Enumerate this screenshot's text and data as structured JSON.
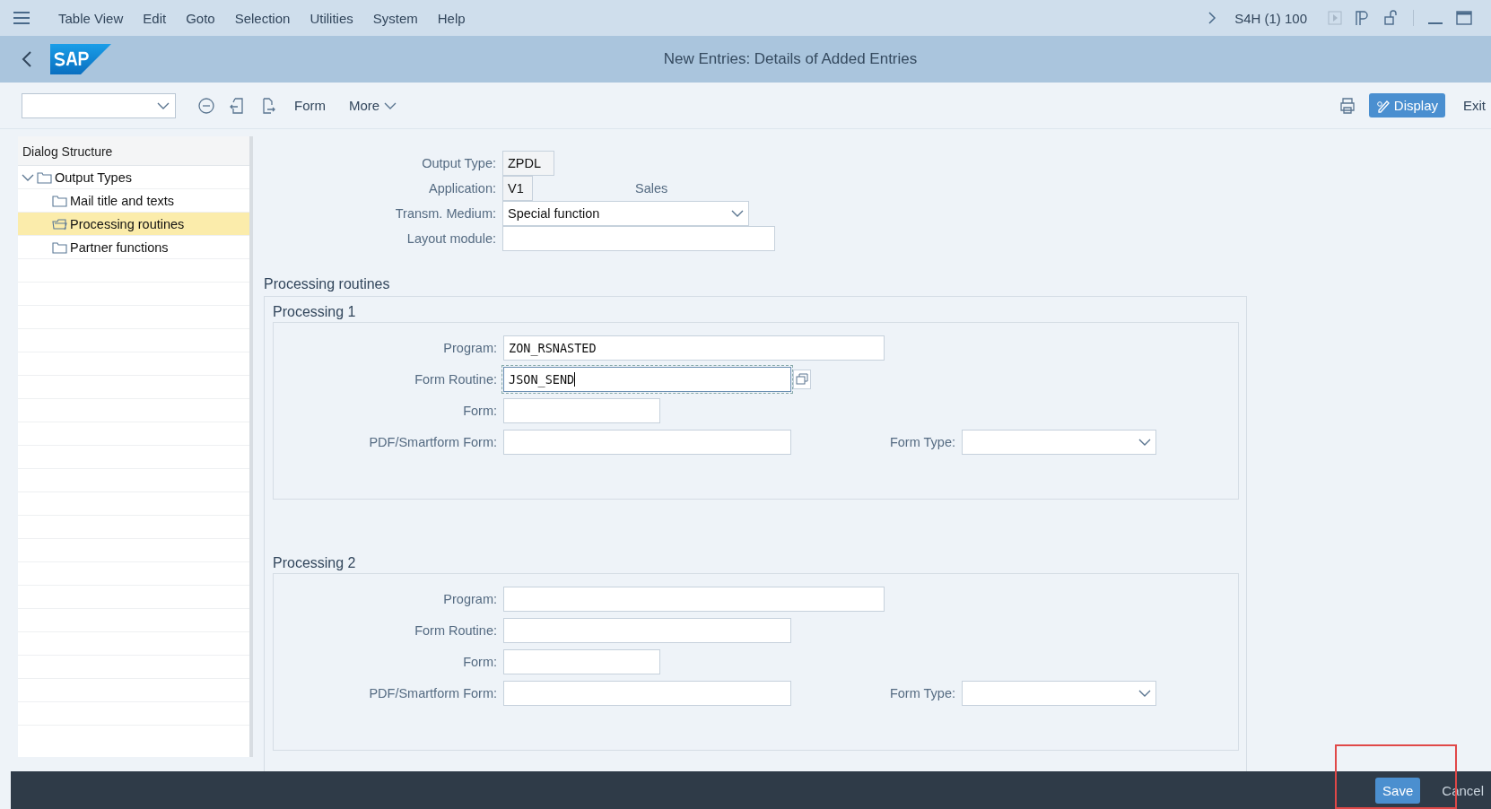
{
  "menu": [
    "Table View",
    "Edit",
    "Goto",
    "Selection",
    "Utilities",
    "System",
    "Help"
  ],
  "system": "S4H (1) 100",
  "title": "New Entries: Details of Added Entries",
  "toolbar": {
    "left": [
      "Form",
      "More"
    ],
    "display": "Display",
    "exit": "Exit"
  },
  "tree": {
    "title": "Dialog Structure",
    "items": [
      {
        "label": "Output Types",
        "expanded": true,
        "selected": false,
        "children": [
          {
            "label": "Mail title and texts",
            "selected": false
          },
          {
            "label": "Processing routines",
            "selected": true
          },
          {
            "label": "Partner functions",
            "selected": false
          }
        ]
      }
    ]
  },
  "header_fields": [
    {
      "label": "Output Type:",
      "value": "ZPDL",
      "kind": "readonly"
    },
    {
      "label": "Application:",
      "value": "V1",
      "kind": "readonly",
      "note": "Sales"
    },
    {
      "label": "Transm. Medium:",
      "value": "Special function",
      "kind": "dropdown"
    },
    {
      "label": "Layout module:",
      "kind": "input"
    }
  ],
  "section": "Processing routines",
  "groups": [
    {
      "title": "Processing 1",
      "program": {
        "label": "Program:",
        "value": "ZON_RSNASTED"
      },
      "routine": {
        "label": "Form Routine:",
        "value": "JSON_SEND",
        "focused": true
      },
      "form": {
        "label": "Form:"
      },
      "pdf": {
        "label": "PDF/Smartform Form:"
      },
      "form_type": {
        "label": "Form Type:"
      }
    },
    {
      "title": "Processing 2",
      "program": {
        "label": "Program:"
      },
      "routine": {
        "label": "Form Routine:",
        "focused": false
      },
      "form": {
        "label": "Form:"
      },
      "pdf": {
        "label": "PDF/Smartform Form:"
      },
      "form_type": {
        "label": "Form Type:"
      }
    }
  ],
  "footer": [
    {
      "label": "Save",
      "primary": true
    },
    {
      "label": "Cancel",
      "primary": false
    }
  ]
}
